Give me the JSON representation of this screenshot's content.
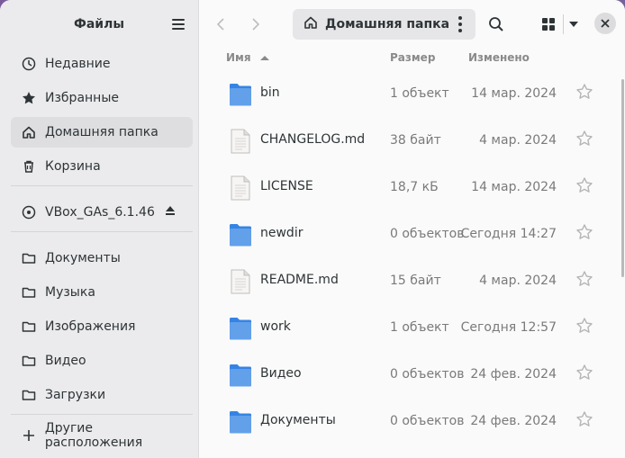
{
  "sidebar": {
    "title": "Файлы",
    "places": [
      {
        "label": "Недавние",
        "icon": "clock-icon"
      },
      {
        "label": "Избранные",
        "icon": "star-icon"
      },
      {
        "label": "Домашняя папка",
        "icon": "home-icon",
        "active": true
      },
      {
        "label": "Корзина",
        "icon": "trash-icon"
      }
    ],
    "devices": [
      {
        "label": "VBox_GAs_6.1.46",
        "icon": "disc-icon"
      }
    ],
    "bookmarks": [
      {
        "label": "Документы",
        "icon": "folder-icon"
      },
      {
        "label": "Музыка",
        "icon": "folder-icon"
      },
      {
        "label": "Изображения",
        "icon": "folder-icon"
      },
      {
        "label": "Видео",
        "icon": "folder-icon"
      },
      {
        "label": "Загрузки",
        "icon": "folder-icon"
      }
    ],
    "other_locations": "Другие расположения"
  },
  "toolbar": {
    "path_label": "Домашняя папка"
  },
  "columns": {
    "name": "Имя",
    "size": "Размер",
    "modified": "Изменено"
  },
  "files": [
    {
      "name": "bin",
      "size": "1 объект",
      "modified": "14 мар. 2024",
      "type": "folder"
    },
    {
      "name": "CHANGELOG.md",
      "size": "38 байт",
      "modified": "4 мар. 2024",
      "type": "file"
    },
    {
      "name": "LICENSE",
      "size": "18,7 кБ",
      "modified": "14 мар. 2024",
      "type": "file"
    },
    {
      "name": "newdir",
      "size": "0 объектов",
      "modified": "Сегодня 14:27",
      "type": "folder"
    },
    {
      "name": "README.md",
      "size": "15 байт",
      "modified": "4 мар. 2024",
      "type": "file"
    },
    {
      "name": "work",
      "size": "1 объект",
      "modified": "Сегодня 12:57",
      "type": "folder"
    },
    {
      "name": "Видео",
      "size": "0 объектов",
      "modified": "24 фев. 2024",
      "type": "folder"
    },
    {
      "name": "Документы",
      "size": "0 объектов",
      "modified": "24 фев. 2024",
      "type": "folder"
    }
  ],
  "colors": {
    "folder": "#62a0ea",
    "folder_dark": "#3584e4",
    "sidebar_bg": "#ebebed",
    "active_bg": "#dedee0"
  }
}
